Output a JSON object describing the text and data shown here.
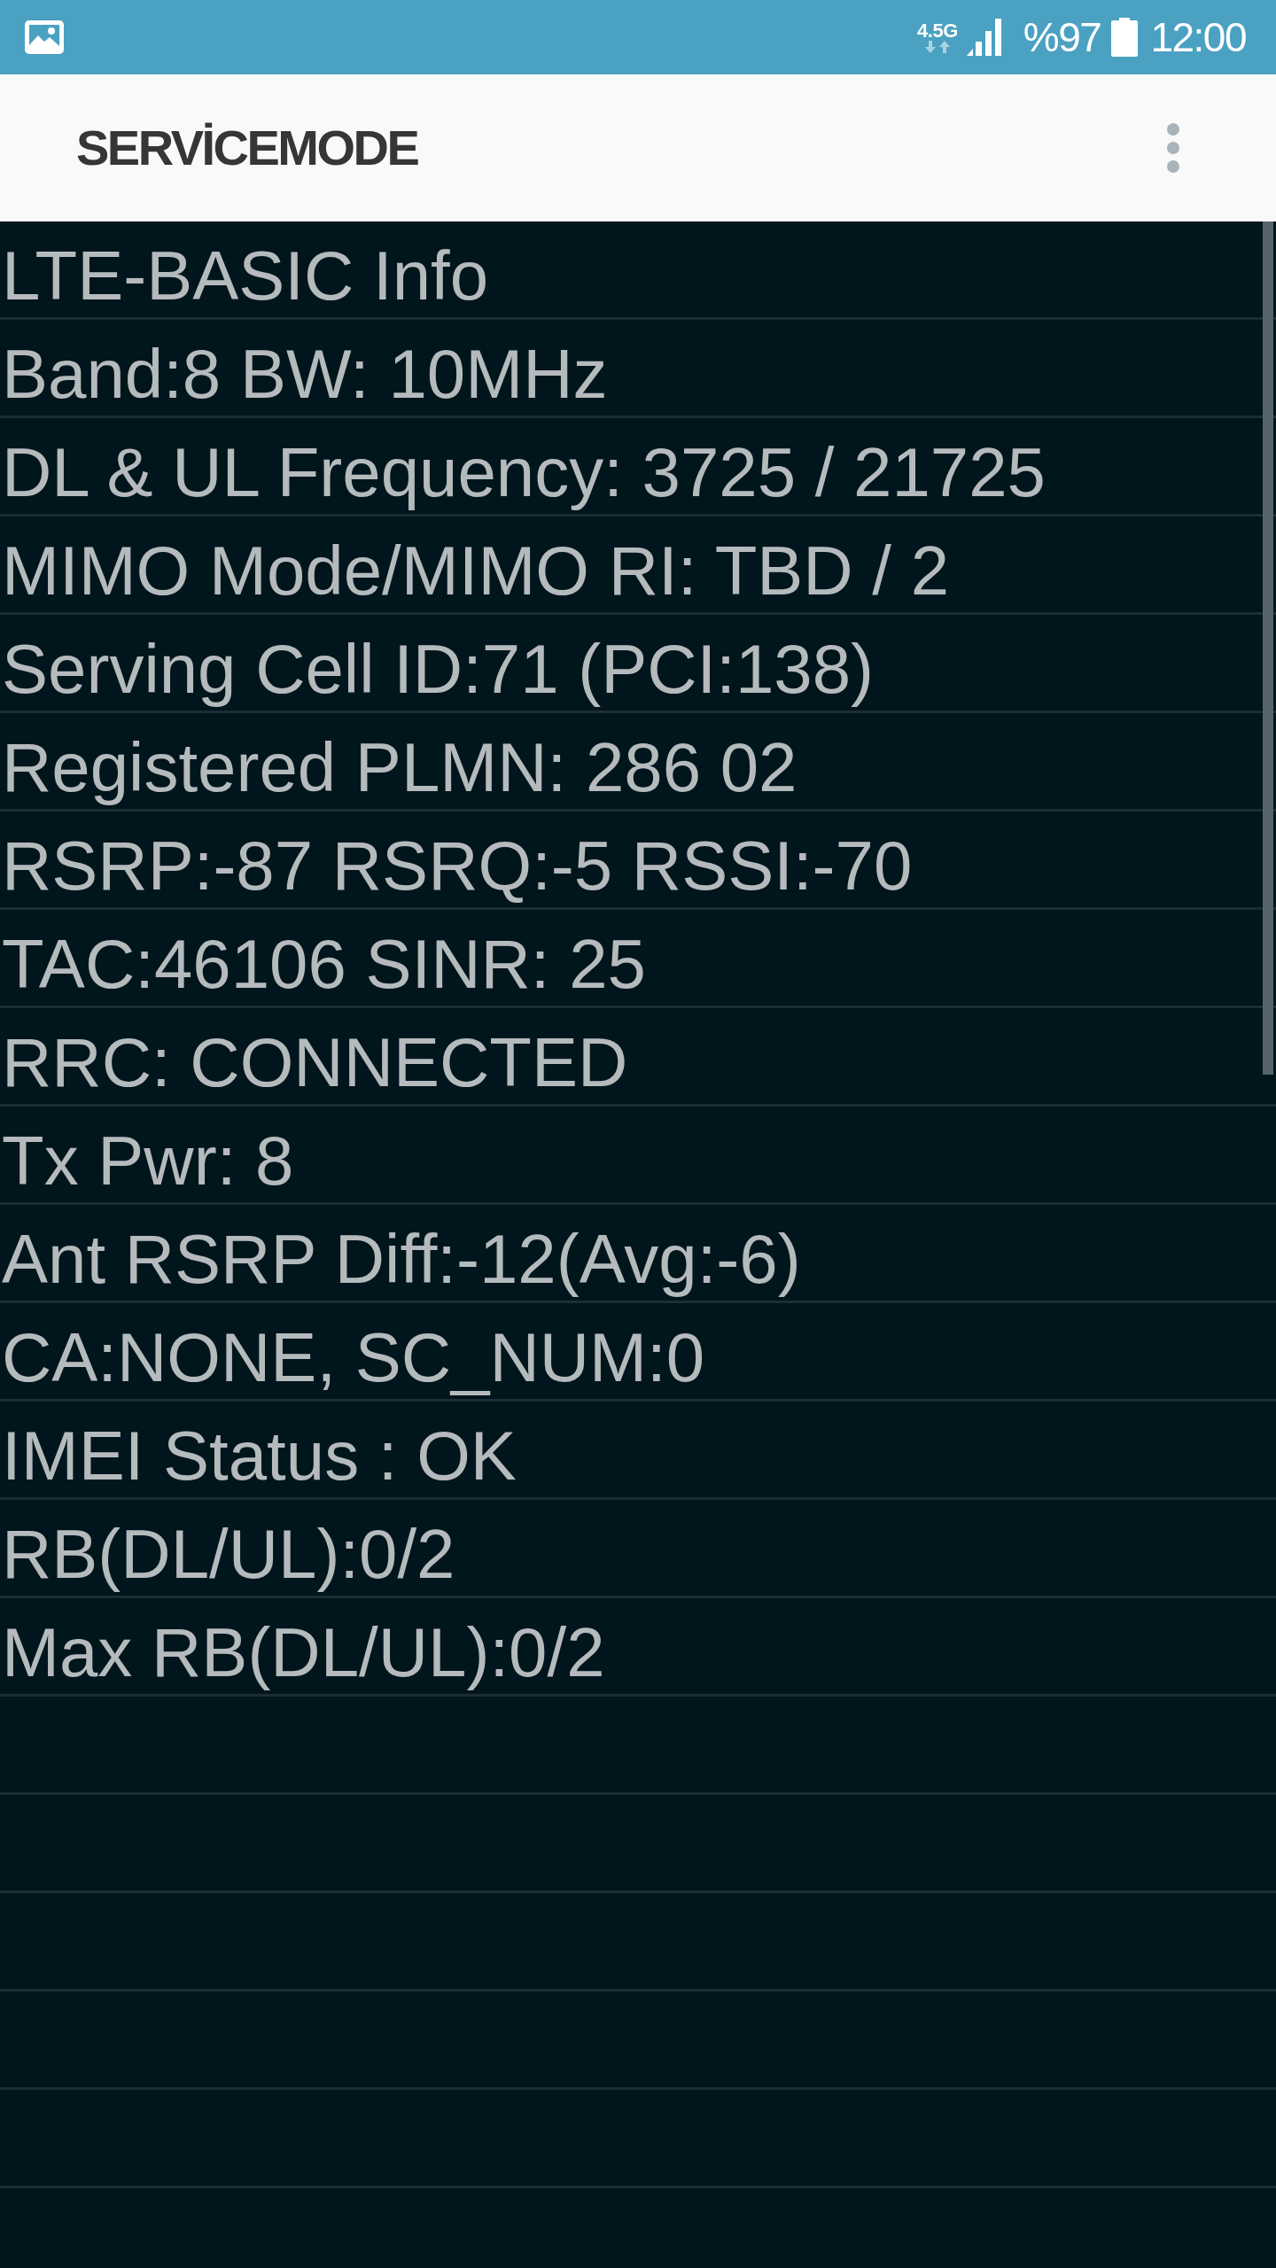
{
  "status_bar": {
    "network_type": "4.5G",
    "battery": "%97",
    "time": "12:00"
  },
  "app_bar": {
    "title": "SERVİCEMODE"
  },
  "rows": [
    "LTE-BASIC Info",
    "Band:8 BW: 10MHz",
    "DL & UL Frequency: 3725 / 21725",
    "MIMO Mode/MIMO RI: TBD / 2",
    "Serving Cell ID:71 (PCI:138)",
    "Registered PLMN: 286 02",
    "RSRP:-87 RSRQ:-5 RSSI:-70",
    "TAC:46106 SINR: 25",
    "RRC: CONNECTED",
    "Tx Pwr: 8",
    "Ant RSRP Diff:-12(Avg:-6)",
    "CA:NONE, SC_NUM:0",
    "IMEI Status : OK",
    "RB(DL/UL):0/2",
    "Max RB(DL/UL):0/2"
  ]
}
